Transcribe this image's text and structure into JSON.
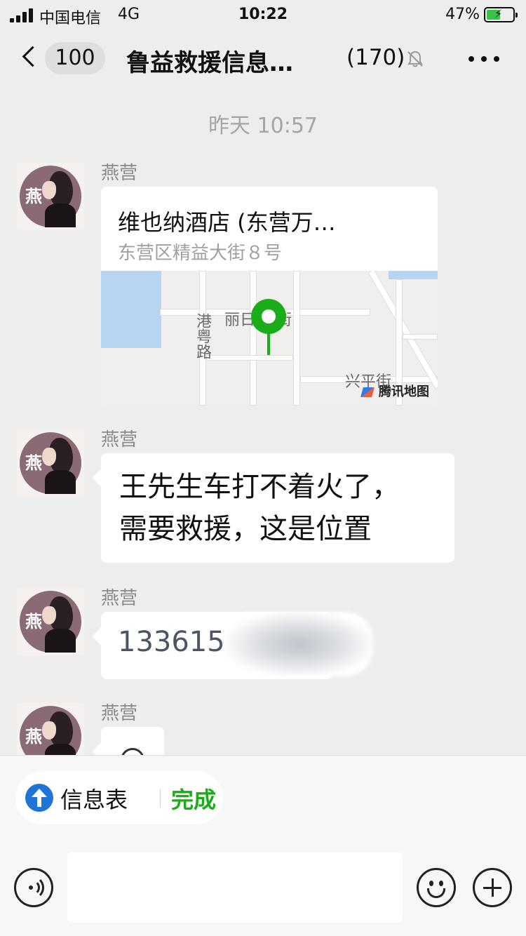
{
  "status_bar": {
    "carrier": "中国电信",
    "network": "4G",
    "time": "10:22",
    "battery_percent": "47%",
    "battery_level": 0.47,
    "battery_icon": "battery-charging-icon",
    "signal_icon": "signal-bars-icon"
  },
  "nav": {
    "unread_badge": "100",
    "title": "鲁益救援信息…",
    "member_count": "(170)",
    "icons": [
      "back-chevron-icon",
      "mute-bell-icon",
      "more-dots-icon"
    ]
  },
  "chat": {
    "timestamp": "昨天 10:57",
    "messages": [
      {
        "sender": "燕营",
        "type": "location",
        "place": "维也纳酒店 (东营万…",
        "address": "东营区精益大街８号",
        "map_labels": [
          "丽日",
          "街",
          "港粤路",
          "兴平街"
        ],
        "map_provider": "腾讯地图"
      },
      {
        "sender": "燕营",
        "type": "text",
        "lines": [
          "王先生车打不着火了，",
          "需要救援，这是位置"
        ]
      },
      {
        "sender": "燕营",
        "type": "text",
        "text": "133615"
      },
      {
        "sender": "燕营",
        "type": "partial"
      }
    ],
    "avatar_char": "燕"
  },
  "bottom": {
    "chip_label": "信息表",
    "chip_action": "完成",
    "input_value": "",
    "colors": {
      "accent_green": "#1aad19",
      "chip_icon_blue": "#1f74d6"
    }
  }
}
